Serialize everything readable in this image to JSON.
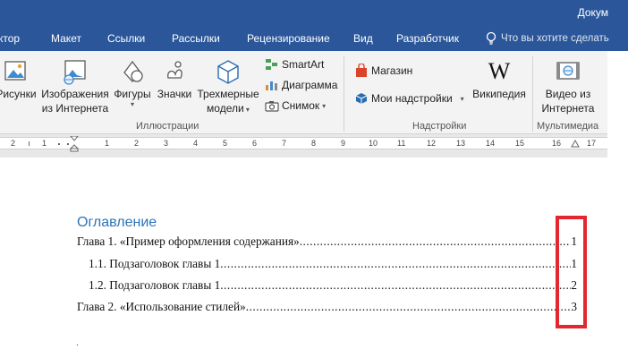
{
  "window": {
    "title": "Докум"
  },
  "tabs": [
    {
      "label": "ктор"
    },
    {
      "label": "Макет"
    },
    {
      "label": "Ссылки"
    },
    {
      "label": "Рассылки"
    },
    {
      "label": "Рецензирование"
    },
    {
      "label": "Вид"
    },
    {
      "label": "Разработчик"
    }
  ],
  "tell_me": {
    "placeholder": "Что вы хотите сделать"
  },
  "ribbon": {
    "illustrations": {
      "pictures": "Рисунки",
      "online_pictures_line1": "Изображения",
      "online_pictures_line2": "из Интернета",
      "shapes": "Фигуры",
      "icons": "Значки",
      "models_line1": "Трехмерные",
      "models_line2": "модели",
      "smartart": "SmartArt",
      "chart": "Диаграмма",
      "screenshot": "Снимок",
      "group_label": "Иллюстрации"
    },
    "addins": {
      "store": "Магазин",
      "my_addins": "Мои надстройки",
      "wikipedia": "Википедия",
      "group_label": "Надстройки"
    },
    "media": {
      "online_video_line1": "Видео из",
      "online_video_line2": "Интернета",
      "group_label": "Мультимедиа"
    }
  },
  "ruler": {
    "labels": [
      "2",
      "1",
      "1",
      "2",
      "3",
      "4",
      "5",
      "6",
      "7",
      "8",
      "9",
      "10",
      "11",
      "12",
      "13",
      "14",
      "15",
      "16",
      "17"
    ]
  },
  "document": {
    "toc_heading": "Оглавление",
    "entries": [
      {
        "title": "Глава 1. «Пример оформления содержания»",
        "page": "1"
      },
      {
        "title": "1.1. Подзаголовок главы 1",
        "page": "1"
      },
      {
        "title": "1.2. Подзаголовок главы 1",
        "page": "2"
      },
      {
        "title": "Глава 2. «Использование стилей»",
        "page": "3"
      }
    ],
    "trailing_mark": "."
  },
  "colors": {
    "ribbon_blue": "#2b579a",
    "heading_blue": "#2e74b5",
    "highlight_red": "#e3262f"
  }
}
